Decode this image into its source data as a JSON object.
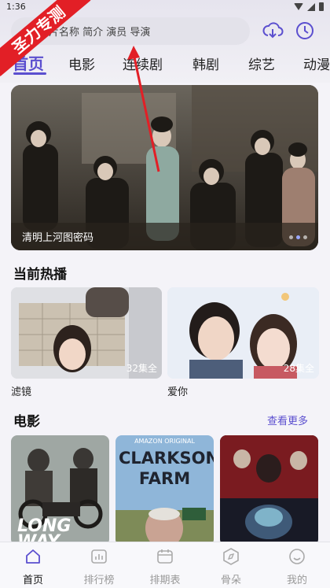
{
  "status": {
    "time": "1:36"
  },
  "search": {
    "placeholder": "片名称 简介 演员 导演"
  },
  "tabs": [
    "首页",
    "电影",
    "连续剧",
    "韩剧",
    "综艺",
    "动漫"
  ],
  "banner": {
    "caption": "清明上河图密码",
    "page_total": 3,
    "page_current": 2
  },
  "sections": {
    "now_playing": "当前热播",
    "movies": "电影",
    "more": "查看更多"
  },
  "now_playing": [
    {
      "title": "滤镜",
      "badge": "32集全"
    },
    {
      "title": "爱你",
      "badge": "28集全"
    }
  ],
  "movies_list": [
    {
      "poster_text": "LONG WAY HOME"
    },
    {
      "poster_top": "AMAZON ORIGINAL",
      "poster_text": "CLARKSON'S FARM"
    },
    {
      "poster_text": ""
    }
  ],
  "bottom_nav": [
    "首页",
    "排行榜",
    "排期表",
    "骨朵",
    "我的"
  ],
  "stamp": "圣力专测",
  "colors": {
    "accent": "#5b4fcf",
    "stamp": "#e21f26",
    "arrow": "#e21f26"
  }
}
